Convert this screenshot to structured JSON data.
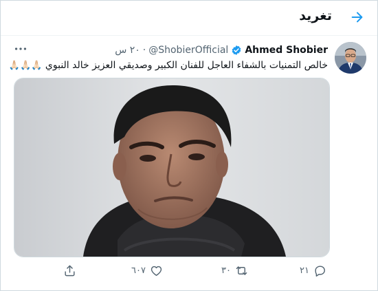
{
  "header": {
    "title": "تغريد",
    "back_icon": "arrow-right-icon"
  },
  "tweet": {
    "author_name": "Ahmed Shobier",
    "verified_icon": "verified-badge-icon",
    "handle": "@ShobierOfficial",
    "separator": "·",
    "time": "٢٠ س",
    "text": "خالص التمنيات بالشفاء العاجل للفنان الكبير وصديقي العزيز خالد النبوي",
    "emoji": "🙏🏻🙏🏻🙏🏻",
    "more_icon": "more-horizontal-icon"
  },
  "actions": {
    "reply_count": "٢١",
    "retweet_count": "٣٠",
    "like_count": "٦٠٧",
    "reply_icon": "reply-icon",
    "retweet_icon": "retweet-icon",
    "like_icon": "heart-icon",
    "share_icon": "share-icon"
  },
  "colors": {
    "accent": "#1d9bf0",
    "text_primary": "#0f1419",
    "text_secondary": "#536471",
    "border": "#cfd9de"
  }
}
